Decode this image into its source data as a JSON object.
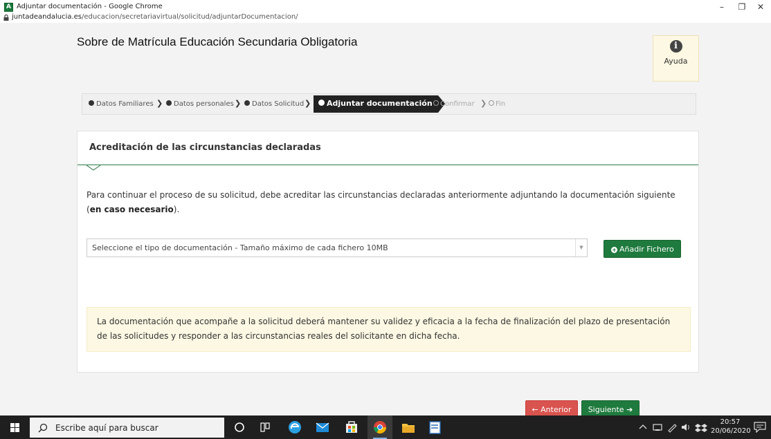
{
  "window": {
    "title": "Adjuntar documentación - Google Chrome",
    "app_icon_letter": "A",
    "minimize": "–",
    "maximize": "❐",
    "close": "✕"
  },
  "address": {
    "domain": "juntadeandalucia.es",
    "path": "/educacion/secretariavirtual/solicitud/adjuntarDocumentacion/"
  },
  "page": {
    "heading": "Sobre de Matrícula Educación Secundaria Obligatoria",
    "help_label": "Ayuda",
    "help_icon": "i"
  },
  "steps": [
    {
      "label": "Datos Familiares",
      "state": "done"
    },
    {
      "label": "Datos personales",
      "state": "done"
    },
    {
      "label": "Datos Solicitud",
      "state": "done"
    },
    {
      "label": "Adjuntar documentación",
      "state": "active"
    },
    {
      "label": "Confirmar",
      "state": "pending"
    },
    {
      "label": "Fin",
      "state": "pending"
    }
  ],
  "step_separator": "❯",
  "panel": {
    "title": "Acreditación de las circunstancias declaradas",
    "intro_text": "Para continuar el proceso de su solicitud, debe acreditar las circunstancias declaradas anteriormente adjuntando la documentación siguiente (",
    "intro_bold": "en caso necesario",
    "intro_end": ").",
    "select_value": "Seleccione el tipo de documentación - Tamaño máximo de cada fichero 10MB",
    "select_arrow": "▼",
    "add_button": "Añadir Fichero",
    "add_icon": "+",
    "notice": "La documentación que acompañe a la solicitud deberá mantener su validez y eficacia a la fecha de finalización del plazo de presentación de las solicitudes y responder a las circunstancias reales del solicitante en dicha fecha."
  },
  "nav": {
    "previous": "← Anterior",
    "next": "Siguiente ➔"
  },
  "taskbar": {
    "search_placeholder": "Escribe aquí para buscar",
    "time": "20:57",
    "date": "20/06/2020",
    "tray_icons": [
      "chevron-up-icon",
      "network-icon",
      "pen-icon",
      "volume-icon",
      "dropbox-icon"
    ]
  },
  "colors": {
    "primary_green": "#1f7a3e",
    "danger_red": "#d9534f",
    "notice_bg": "#fcf8e3"
  }
}
